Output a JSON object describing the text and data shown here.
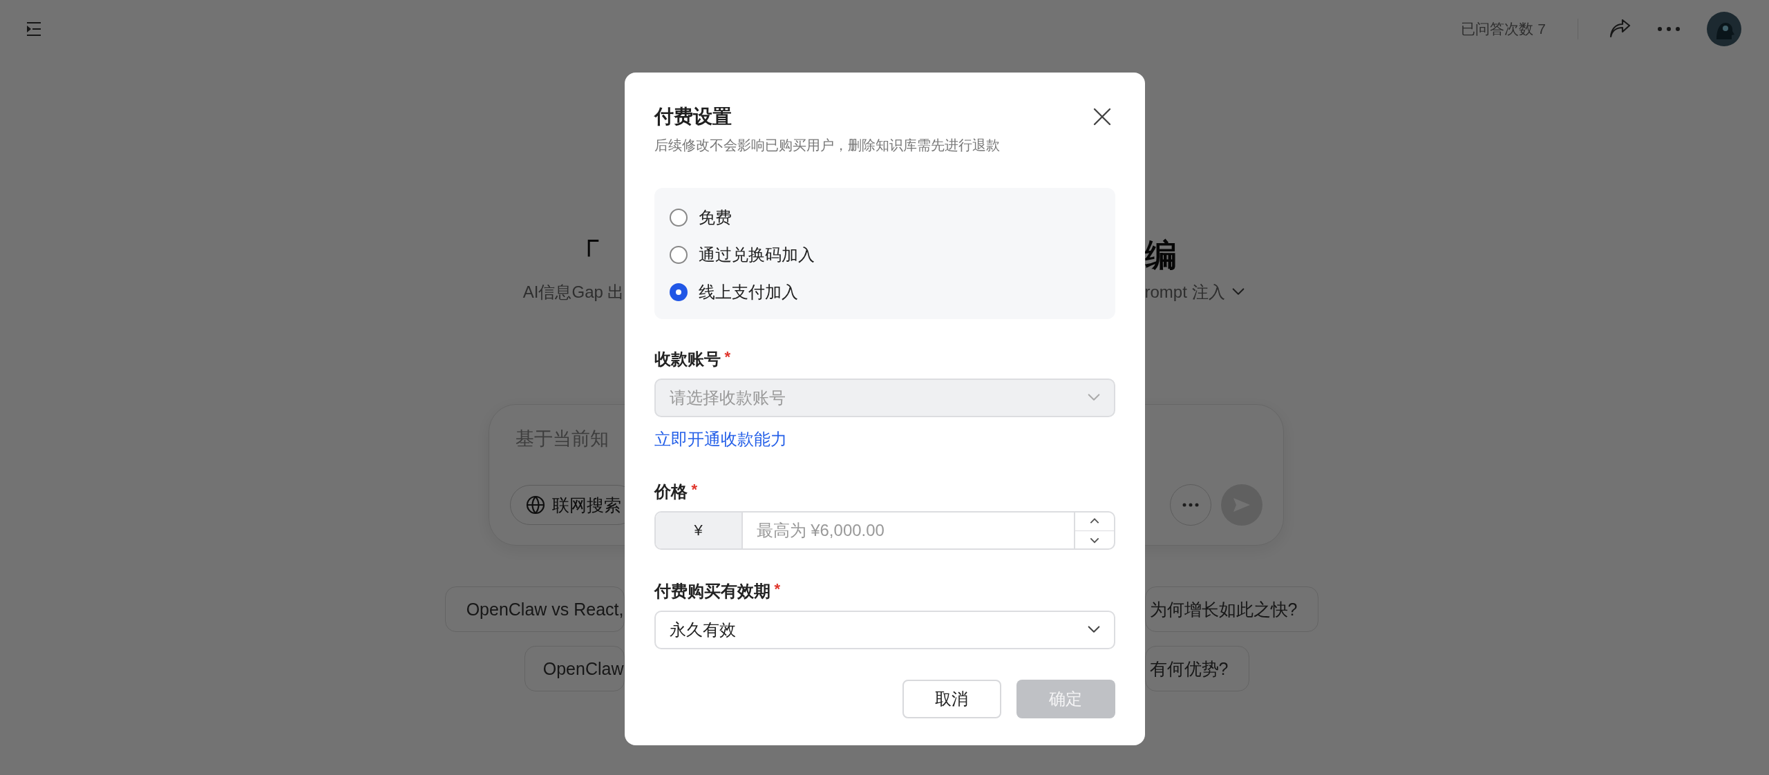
{
  "top_bar": {
    "answer_count": "已问答次数 7"
  },
  "hero": {
    "title_left": "「",
    "title_right": "编",
    "subtitle_left": "AI信息Gap 出",
    "subtitle_right": "rompt 注入"
  },
  "composer": {
    "placeholder": "基于当前知",
    "web_search": "联网搜索"
  },
  "suggestions": [
    {
      "left": "OpenClaw vs React,",
      "right": "为何增长如此之快?"
    },
    {
      "left": "OpenClaw",
      "right": "有何优势?"
    }
  ],
  "dialog": {
    "title": "付费设置",
    "subtitle": "后续修改不会影响已购买用户，删除知识库需先进行退款",
    "options": [
      {
        "label": "免费",
        "selected": false
      },
      {
        "label": "通过兑换码加入",
        "selected": false
      },
      {
        "label": "线上支付加入",
        "selected": true
      }
    ],
    "account": {
      "label": "收款账号",
      "mark": "*",
      "placeholder": "请选择收款账号",
      "disabled": true
    },
    "activate_link": "立即开通收款能力",
    "price": {
      "label": "价格",
      "mark": "*",
      "prefix": "¥",
      "placeholder": "最高为 ¥6,000.00"
    },
    "validity": {
      "label": "付费购买有效期",
      "mark": "*",
      "value": "永久有效"
    },
    "buttons": [
      {
        "label": "取消",
        "kind": "secondary",
        "disabled": false
      },
      {
        "label": "确定",
        "kind": "primary",
        "disabled": true
      }
    ]
  }
}
